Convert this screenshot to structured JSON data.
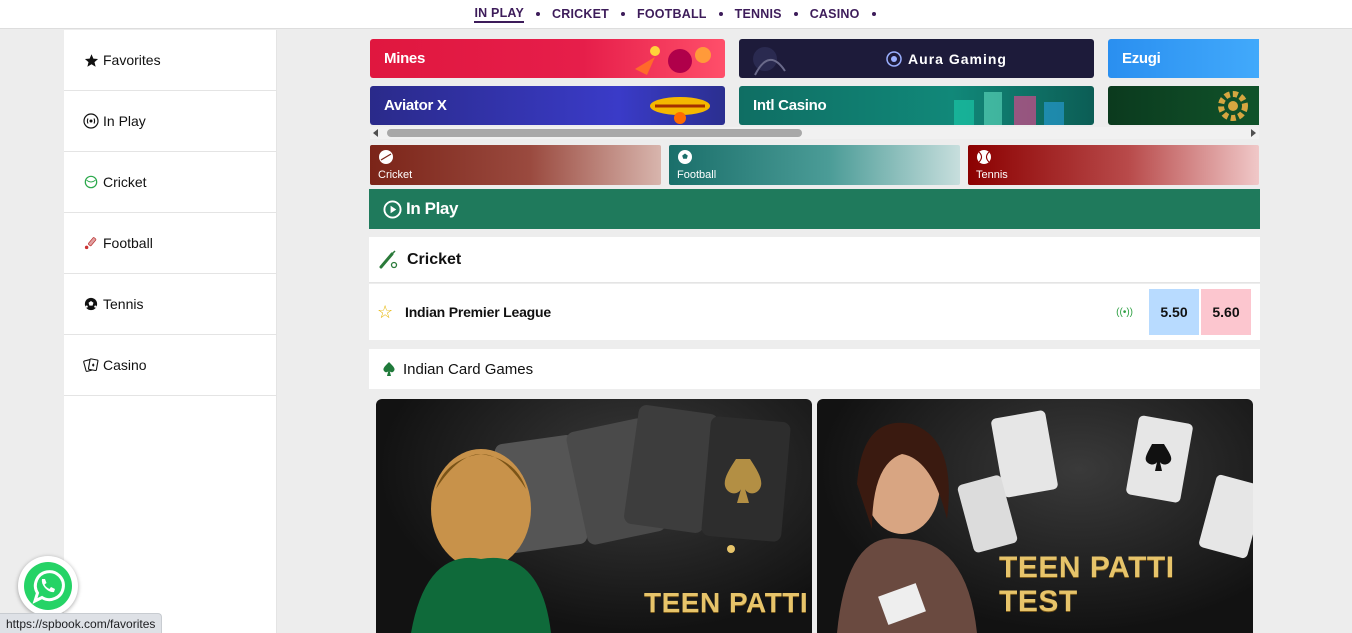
{
  "topnav": {
    "items": [
      "IN PLAY",
      "CRICKET",
      "FOOTBALL",
      "TENNIS",
      "CASINO"
    ]
  },
  "sidebar": {
    "items": [
      {
        "label": "Favorites",
        "icon": "star-icon"
      },
      {
        "label": "In Play",
        "icon": "live-icon"
      },
      {
        "label": "Cricket",
        "icon": "cricket-ball-icon"
      },
      {
        "label": "Football",
        "icon": "cricket-bat-icon"
      },
      {
        "label": "Tennis",
        "icon": "soccer-ball-icon"
      },
      {
        "label": "Casino",
        "icon": "cards-icon"
      }
    ]
  },
  "games": [
    {
      "label": "Mines",
      "color": "#e0173f"
    },
    {
      "label": "Aura Gaming",
      "color": "#1d1b3a"
    },
    {
      "label": "Ezugi",
      "color": "#2996f0"
    },
    {
      "label": "Aviator X",
      "color": "#2e2c9c"
    },
    {
      "label": "Intl Casino",
      "color": "#0f6e63"
    },
    {
      "label": "",
      "color": "#0b3a1e"
    }
  ],
  "sports": [
    {
      "label": "Cricket",
      "color": "#7b2418"
    },
    {
      "label": "Football",
      "color": "#1a6f6a"
    },
    {
      "label": "Tennis",
      "color": "#8b0000"
    }
  ],
  "inplay": {
    "title": "In Play"
  },
  "cricket": {
    "title": "Cricket",
    "match": {
      "name": "Indian Premier League",
      "back": "5.50",
      "lay": "5.60"
    }
  },
  "cardgames": {
    "title": "Indian Card Games",
    "tiles": [
      "TEEN PATTI",
      "TEEN PATTI TEST"
    ]
  },
  "status": {
    "url": "https://spbook.com/favorites"
  }
}
